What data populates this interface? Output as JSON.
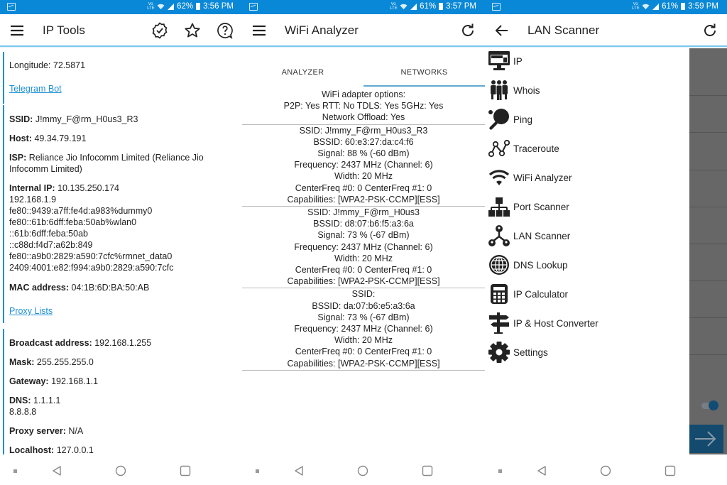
{
  "screens": {
    "ip_tools": {
      "status": {
        "battery": "62%",
        "time": "3:56 PM",
        "network": "VoLTE"
      },
      "title": "IP Tools",
      "actions": [
        "verified-badge-icon",
        "star-icon",
        "help-icon"
      ],
      "card1": {
        "longitude_label": "Longitude:",
        "longitude_value": "72.5871",
        "telegram_link": "Telegram Bot"
      },
      "card2": {
        "ssid_label": "SSID:",
        "ssid_value": "J!mmy_F@rm_H0us3_R3",
        "host_label": "Host:",
        "host_value": "49.34.79.191",
        "isp_label": "ISP:",
        "isp_value": "Reliance Jio Infocomm Limited (Reliance Jio Infocomm Limited)",
        "internal_ip_label": "Internal IP:",
        "internal_ip_values": [
          "10.135.250.174",
          "192.168.1.9",
          "fe80::9439:a7ff:fe4d:a983%dummy0",
          "fe80::61b:6dff:feba:50ab%wlan0",
          "::61b:6dff:feba:50ab",
          "::c88d:f4d7:a62b:849",
          "fe80::a9b0:2829:a590:7cfc%rmnet_data0",
          "2409:4001:e82:f994:a9b0:2829:a590:7cfc"
        ],
        "mac_label": "MAC address:",
        "mac_value": "04:1B:6D:BA:50:AB",
        "proxy_link": "Proxy Lists"
      },
      "card3": {
        "broadcast_label": "Broadcast address:",
        "broadcast_value": "192.168.1.255",
        "mask_label": "Mask:",
        "mask_value": "255.255.255.0",
        "gateway_label": "Gateway:",
        "gateway_value": "192.168.1.1",
        "dns_label": "DNS:",
        "dns_values": [
          "1.1.1.1",
          "8.8.8.8"
        ],
        "proxy_label": "Proxy server:",
        "proxy_value": "N/A",
        "localhost_label": "Localhost:",
        "localhost_value": "127.0.0.1"
      }
    },
    "wifi_analyzer": {
      "status": {
        "battery": "61%",
        "time": "3:57 PM",
        "network": "VoLTE"
      },
      "title": "WiFi Analyzer",
      "tabs": [
        {
          "label": "ANALYZER",
          "active": false
        },
        {
          "label": "NETWORKS",
          "active": true
        }
      ],
      "adapter_options": [
        "WiFi adapter options:",
        "P2P: Yes RTT: No TDLS: Yes 5GHz: Yes",
        "Network Offload: Yes"
      ],
      "networks": [
        {
          "ssid": "SSID: J!mmy_F@rm_H0us3_R3",
          "bssid": "BSSID: 60:e3:27:da:c4:f6",
          "signal": "Signal: 88 % (-60 dBm)",
          "frequency": "Frequency: 2437 MHz (Channel: 6)",
          "width": "Width: 20 MHz",
          "center_freq": "CenterFreq #0: 0 CenterFreq #1: 0",
          "capabilities": "Capabilities: [WPA2-PSK-CCMP][ESS]"
        },
        {
          "ssid": "SSID: J!mmy_F@rm_H0us3",
          "bssid": "BSSID: d8:07:b6:f5:a3:6a",
          "signal": "Signal: 73 % (-67 dBm)",
          "frequency": "Frequency: 2437 MHz (Channel: 6)",
          "width": "Width: 20 MHz",
          "center_freq": "CenterFreq #0: 0 CenterFreq #1: 0",
          "capabilities": "Capabilities: [WPA2-PSK-CCMP][ESS]"
        },
        {
          "ssid": "SSID:",
          "bssid": "BSSID: da:07:b6:e5:a3:6a",
          "signal": "Signal: 73 % (-67 dBm)",
          "frequency": "Frequency: 2437 MHz (Channel: 6)",
          "width": "Width: 20 MHz",
          "center_freq": "CenterFreq #0: 0 CenterFreq #1: 0",
          "capabilities": "Capabilities: [WPA2-PSK-CCMP][ESS]"
        }
      ]
    },
    "lan_scanner": {
      "status": {
        "battery": "61%",
        "time": "3:59 PM",
        "network": "VoLTE"
      },
      "title": "LAN Scanner",
      "drawer_items": [
        {
          "label": "IP",
          "icon": "monitor-icon"
        },
        {
          "label": "Whois",
          "icon": "people-icon"
        },
        {
          "label": "Ping",
          "icon": "ping-pong-icon"
        },
        {
          "label": "Traceroute",
          "icon": "traceroute-icon"
        },
        {
          "label": "WiFi Analyzer",
          "icon": "wifi-icon"
        },
        {
          "label": "Port Scanner",
          "icon": "network-tree-icon"
        },
        {
          "label": "LAN Scanner",
          "icon": "lan-users-icon"
        },
        {
          "label": "DNS Lookup",
          "icon": "globe-icon"
        },
        {
          "label": "IP Calculator",
          "icon": "calculator-icon"
        },
        {
          "label": "IP & Host Converter",
          "icon": "signpost-icon"
        },
        {
          "label": "Settings",
          "icon": "gear-icon"
        }
      ],
      "toggle_on": true
    }
  },
  "navbar": [
    "recent-dot-icon",
    "back-icon",
    "home-icon",
    "overview-icon"
  ],
  "colors": {
    "statusbar": "#0a88d8",
    "accent": "#1e8fd6",
    "tab_indicator": "#5fa9d0",
    "scrim": "#676767",
    "fab": "#134a6e"
  }
}
